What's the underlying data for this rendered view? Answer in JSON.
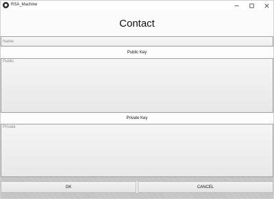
{
  "window": {
    "title": "RSA_Machine"
  },
  "header": {
    "title": "Contact"
  },
  "form": {
    "name_placeholder": "Name",
    "name_value": "",
    "public_key_label": "Public Key",
    "public_placeholder": "Public",
    "public_value": "",
    "private_key_label": "Private Key",
    "private_placeholder": "Private",
    "private_value": ""
  },
  "actions": {
    "ok_label": "OK",
    "cancel_label": "CANCEL"
  }
}
